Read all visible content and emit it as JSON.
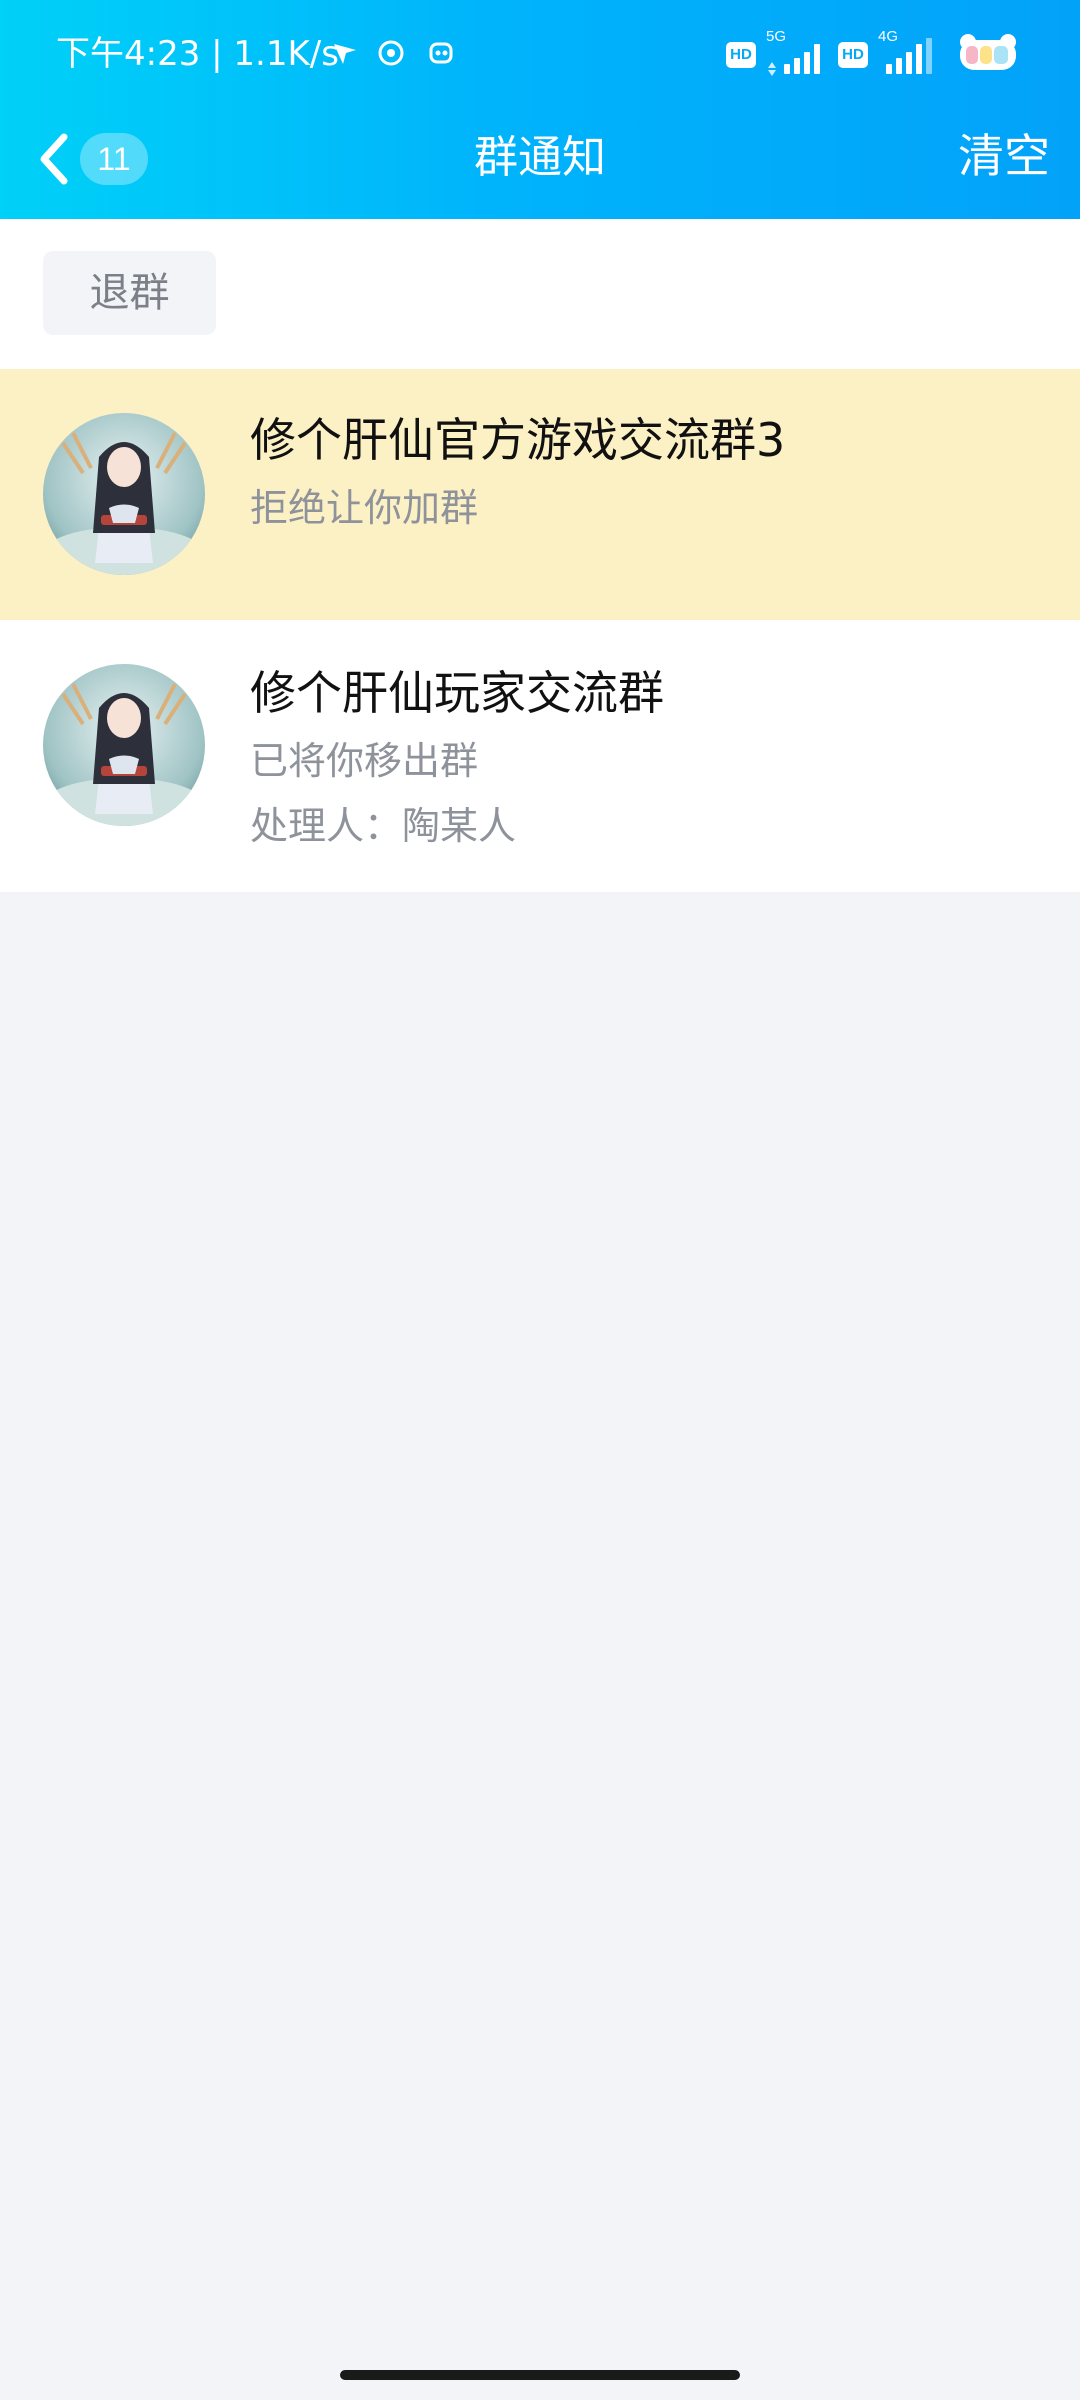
{
  "status_bar": {
    "time_speed": "下午4:23 | 1.1K/s",
    "hd_badge": "HD",
    "network_1": "5G",
    "network_2": "4G"
  },
  "nav": {
    "back_count": "11",
    "title": "群通知",
    "clear_label": "清空"
  },
  "filter": {
    "chip_label": "退群"
  },
  "notices": [
    {
      "group_name": "修个肝仙官方游戏交流群3",
      "message": "拒绝让你加群",
      "highlighted": true
    },
    {
      "group_name": "修个肝仙玩家交流群",
      "message": "已将你移出群",
      "handler": "处理人：陶某人",
      "highlighted": false
    }
  ],
  "colors": {
    "header_gradient_start": "#00d1f8",
    "header_gradient_end": "#02a2f9",
    "highlight_row": "#fcf0c5",
    "page_background": "#f3f4f8",
    "secondary_text": "#8e929b"
  }
}
